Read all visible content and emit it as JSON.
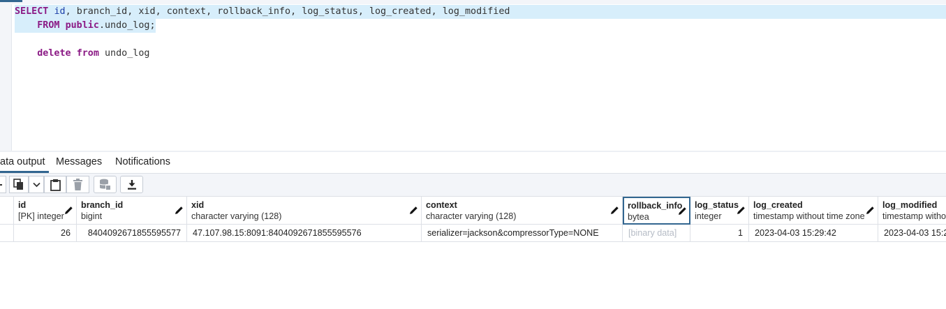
{
  "editor": {
    "line1": {
      "kw1": "SELECT",
      "cols": [
        "id",
        "branch_id",
        "xid",
        "context",
        "rollback_info",
        "log_status",
        "log_created",
        "log_modified"
      ],
      "sep": ", "
    },
    "line2": {
      "kw": "FROM",
      "schema": "public",
      "dot": ".",
      "table": "undo_log",
      "end": ";"
    },
    "line4": {
      "kw1": "delete",
      "kw2": "from",
      "table": "undo_log"
    }
  },
  "tabs": [
    {
      "label": "Data output",
      "visible_label": "ata output",
      "active": true
    },
    {
      "label": "Messages",
      "active": false
    },
    {
      "label": "Notifications",
      "active": false
    }
  ],
  "toolbar": {
    "icons": [
      "copy-icon",
      "chevron-down-icon",
      "paste-icon",
      "trash-icon",
      "database-save-icon",
      "download-icon"
    ]
  },
  "grid": {
    "columns": [
      {
        "name": "id",
        "type": "[PK] integer"
      },
      {
        "name": "branch_id",
        "type": "bigint"
      },
      {
        "name": "xid",
        "type": "character varying (128)"
      },
      {
        "name": "context",
        "type": "character varying (128)"
      },
      {
        "name": "rollback_info",
        "type": "bytea"
      },
      {
        "name": "log_status",
        "type": "integer"
      },
      {
        "name": "log_created",
        "type": "timestamp without time zone"
      },
      {
        "name": "log_modified",
        "type": "timestamp witho"
      }
    ],
    "rows": [
      [
        "26",
        "8404092671855595577",
        "47.107.98.15:8091:8404092671855595576",
        "serializer=jackson&compressorType=NONE",
        "[binary data]",
        "1",
        "2023-04-03 15:29:42",
        "2023-04-03 15:2"
      ]
    ]
  },
  "colors": {
    "keyword": "#8b1a85",
    "identifier": "#1b3fa8",
    "selection": "#d7eefb",
    "accent": "#326690"
  }
}
